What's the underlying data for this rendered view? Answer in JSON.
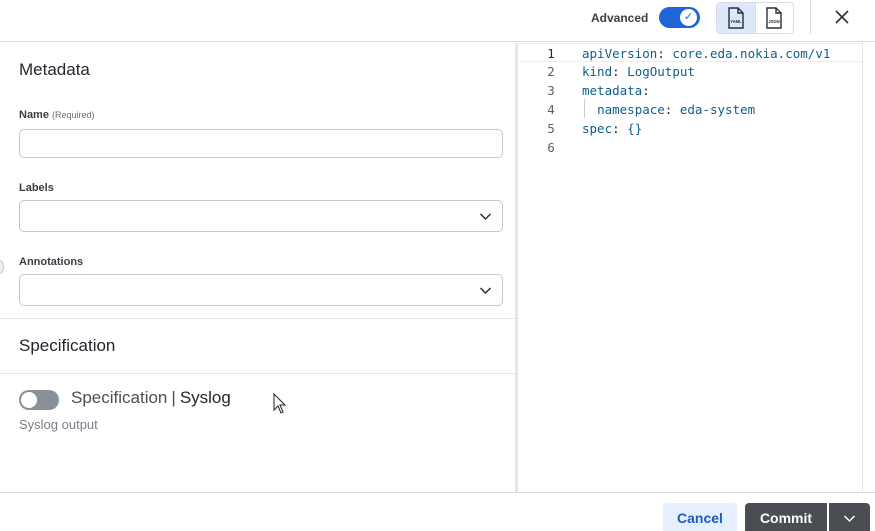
{
  "header": {
    "advanced_label": "Advanced",
    "advanced_enabled": true,
    "format_yaml_label": "YAML",
    "format_json_label": "JSON",
    "close_icon": "close-icon"
  },
  "form": {
    "metadata_title": "Metadata",
    "name": {
      "label": "Name",
      "required_label": "(Required)",
      "value": ""
    },
    "labels": {
      "label": "Labels",
      "value": ""
    },
    "annotations": {
      "label": "Annotations",
      "value": ""
    },
    "specification_title": "Specification",
    "syslog": {
      "toggle_enabled": false,
      "prefix": "Specification",
      "separator": "|",
      "name": "Syslog",
      "description": "Syslog output"
    }
  },
  "editor": {
    "lines": [
      {
        "num": "1",
        "key": "apiVersion",
        "value": "core.eda.nokia.com/v1"
      },
      {
        "num": "2",
        "key": "kind",
        "value": "LogOutput"
      },
      {
        "num": "3",
        "key": "metadata",
        "value": ""
      },
      {
        "num": "4",
        "key": "namespace",
        "value": "eda-system"
      },
      {
        "num": "5",
        "key": "spec",
        "value": "{}"
      },
      {
        "num": "6",
        "key": "",
        "value": ""
      }
    ]
  },
  "footer": {
    "cancel_label": "Cancel",
    "commit_label": "Commit"
  },
  "colors": {
    "accent": "#1e66d6",
    "commit_bg": "#4a4d52",
    "code_key": "#0d5f8a"
  }
}
